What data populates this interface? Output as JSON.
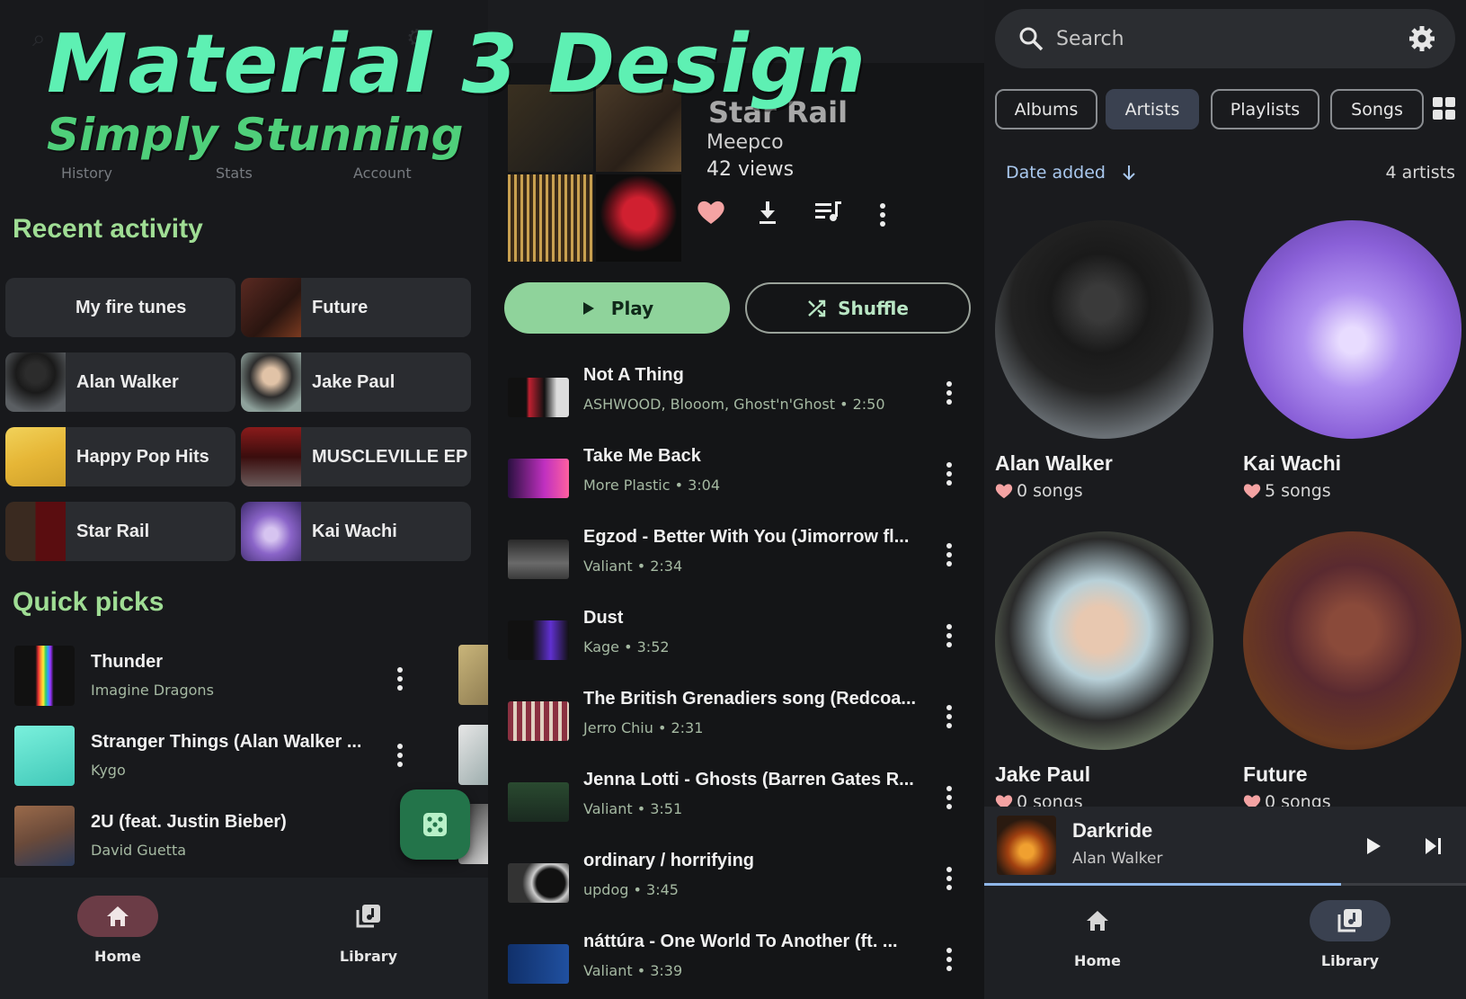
{
  "headline": {
    "title": "Material 3 Design",
    "subtitle": "Simply Stunning"
  },
  "home": {
    "top_tabs": [
      "History",
      "Stats",
      "Account"
    ],
    "recent_title": "Recent activity",
    "recent": [
      "My fire tunes",
      "Future",
      "Alan Walker",
      "Jake Paul",
      "Happy Pop Hits",
      "MUSCLEVILLE EP",
      "Star Rail",
      "Kai Wachi"
    ],
    "quick_title": "Quick picks",
    "quick_picks": [
      {
        "title": "Thunder",
        "artist": "Imagine Dragons"
      },
      {
        "title": "Stranger Things (Alan Walker ...",
        "artist": "Kygo"
      },
      {
        "title": "2U (feat. Justin Bieber)",
        "artist": "David Guetta"
      }
    ],
    "nav": {
      "home": "Home",
      "library": "Library"
    }
  },
  "playlist": {
    "name": "Star Rail",
    "owner": "Meepco",
    "views": "42 views",
    "play_label": "Play",
    "shuffle_label": "Shuffle",
    "songs": [
      {
        "title": "Not A Thing",
        "meta": "ASHWOOD, Blooom, Ghost'n'Ghost • 2:50"
      },
      {
        "title": "Take Me Back",
        "meta": "More Plastic • 3:04"
      },
      {
        "title": "Egzod - Better With You (Jimorrow fl...",
        "meta": "Valiant • 2:34"
      },
      {
        "title": "Dust",
        "meta": "Kage • 3:52"
      },
      {
        "title": "The British Grenadiers song (Redcoa...",
        "meta": "Jerro Chiu • 2:31"
      },
      {
        "title": "Jenna Lotti - Ghosts (Barren Gates R...",
        "meta": "Valiant • 3:51"
      },
      {
        "title": "ordinary / horrifying",
        "meta": "updog • 3:45"
      },
      {
        "title": "náttúra  - One World To Another (ft. ...",
        "meta": "Valiant • 3:39"
      }
    ]
  },
  "library": {
    "search_placeholder": "Search",
    "chips": [
      "Albums",
      "Artists",
      "Playlists",
      "Songs"
    ],
    "active_chip": "Artists",
    "sort_label": "Date added",
    "count": "4 artists",
    "artists": [
      {
        "name": "Alan Walker",
        "songs": "0 songs"
      },
      {
        "name": "Kai Wachi",
        "songs": "5 songs"
      },
      {
        "name": "Jake Paul",
        "songs": "0 songs"
      },
      {
        "name": "Future",
        "songs": "0 songs"
      }
    ],
    "now_playing": {
      "title": "Darkride",
      "artist": "Alan Walker",
      "progress": 0.74
    },
    "nav": {
      "home": "Home",
      "library": "Library"
    }
  },
  "colors": {
    "accent_green": "#8fd39b",
    "headline_green": "#5ef0b3",
    "section_green": "#9fdd94",
    "heart": "#f4a3a3",
    "active_nav_home": "#6b3c46",
    "active_nav_library": "#3a4150"
  }
}
